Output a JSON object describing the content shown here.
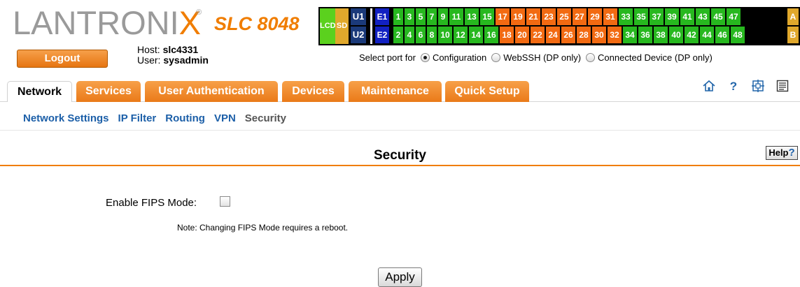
{
  "brand": {
    "logo_text_left": "LANTRONI",
    "logo_text_x": "X",
    "registered": "®",
    "model": "SLC 8048"
  },
  "header": {
    "logout_label": "Logout",
    "host_label": "Host:",
    "host_value": "slc4331",
    "user_label": "User:",
    "user_value": "sysadmin"
  },
  "port_panel": {
    "lcd": "LCD",
    "sd": "SD",
    "u1": "U1",
    "u2": "U2",
    "e1": "E1",
    "e2": "E2",
    "row1": [
      "1",
      "3",
      "5",
      "7",
      "9",
      "11",
      "13",
      "15",
      "17",
      "19",
      "21",
      "23",
      "25",
      "27",
      "29",
      "31",
      "33",
      "35",
      "37",
      "39",
      "41",
      "43",
      "45",
      "47"
    ],
    "row2": [
      "2",
      "4",
      "6",
      "8",
      "10",
      "12",
      "14",
      "16",
      "18",
      "20",
      "22",
      "24",
      "26",
      "28",
      "30",
      "32",
      "34",
      "36",
      "38",
      "40",
      "42",
      "44",
      "46",
      "48"
    ],
    "a": "A",
    "b": "B",
    "colors": {
      "green": "#27b81f",
      "orange": "#f26a12",
      "usb": "#1b3a7a",
      "eth": "#1221c2",
      "gold": "#e0a82c",
      "lcd": "#5bd11e"
    }
  },
  "select_port": {
    "label": "Select port for",
    "options": [
      "Configuration",
      "WebSSH (DP only)",
      "Connected Device (DP only)"
    ],
    "selected": "Configuration"
  },
  "tabs": [
    "Network",
    "Services",
    "User Authentication",
    "Devices",
    "Maintenance",
    "Quick Setup"
  ],
  "active_tab": "Network",
  "tool_icons": [
    "home-icon",
    "help-icon",
    "site-map-icon",
    "log-icon"
  ],
  "subnav": [
    "Network Settings",
    "IP Filter",
    "Routing",
    "VPN",
    "Security"
  ],
  "active_subnav": "Security",
  "page": {
    "title": "Security",
    "help_label": "Help",
    "help_mark": "?",
    "fips_label": "Enable FIPS Mode:",
    "fips_checked": false,
    "note": "Note:  Changing FIPS Mode requires a reboot.",
    "apply_label": "Apply"
  },
  "accent_color": "#f07d00"
}
